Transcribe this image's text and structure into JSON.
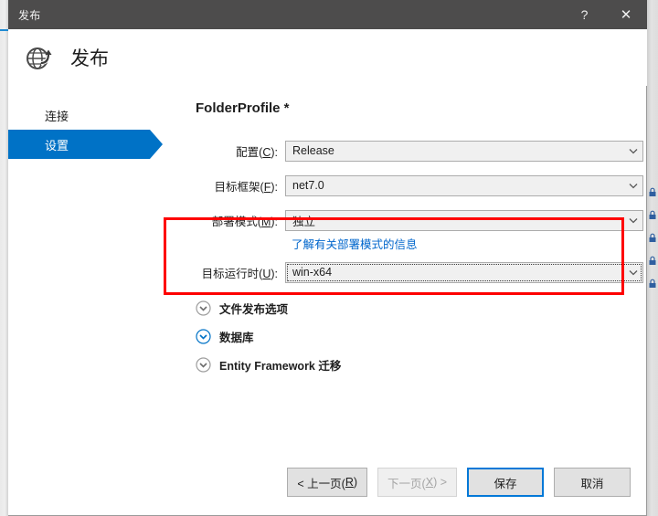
{
  "window": {
    "titlebar_title": "发布",
    "help_button_label": "?",
    "close_button_label": "✕"
  },
  "header": {
    "icon": "globe-publish-icon",
    "title": "发布"
  },
  "sidebar": {
    "items": [
      {
        "label": "连接",
        "selected": false
      },
      {
        "label": "设置",
        "selected": true
      }
    ]
  },
  "main": {
    "profile_title": "FolderProfile *",
    "fields": [
      {
        "label_prefix": "配置(",
        "label_key": "C",
        "label_suffix": "):",
        "value": "Release",
        "name": "configuration"
      },
      {
        "label_prefix": "目标框架(",
        "label_key": "F",
        "label_suffix": "):",
        "value": "net7.0",
        "name": "target-framework"
      },
      {
        "label_prefix": "部署模式(",
        "label_key": "M",
        "label_suffix": "):",
        "value": "独立",
        "name": "deployment-mode"
      },
      {
        "label_prefix": "目标运行时(",
        "label_key": "U",
        "label_suffix": "):",
        "value": "win-x64",
        "name": "target-runtime"
      }
    ],
    "help_link": "了解有关部署模式的信息",
    "expanders": [
      {
        "label": "文件发布选项",
        "highlighted": false
      },
      {
        "label": "数据库",
        "highlighted": true
      },
      {
        "label": "Entity Framework 迁移",
        "highlighted": false
      }
    ]
  },
  "footer": {
    "buttons": [
      {
        "prefix": "< 上一页(",
        "key": "R",
        "suffix": ")",
        "state": "normal",
        "name": "previous-button"
      },
      {
        "prefix": "下一页(",
        "key": "X",
        "suffix": ") >",
        "state": "disabled",
        "name": "next-button"
      },
      {
        "prefix": "保存",
        "key": "",
        "suffix": "",
        "state": "default",
        "name": "save-button"
      },
      {
        "prefix": "取消",
        "key": "",
        "suffix": "",
        "state": "normal",
        "name": "cancel-button"
      }
    ]
  },
  "annotation": {
    "color": "#fe0000",
    "label": "red-highlight-box"
  },
  "background": {
    "lock_icons_count": 5,
    "lock_icon_color": "#2f5fa0"
  },
  "colors": {
    "accent": "#0072c6",
    "titlebar": "#4d4c4c",
    "link": "#0066cc",
    "default_button_border": "#0078d7",
    "annotation_red": "#fe0000"
  }
}
